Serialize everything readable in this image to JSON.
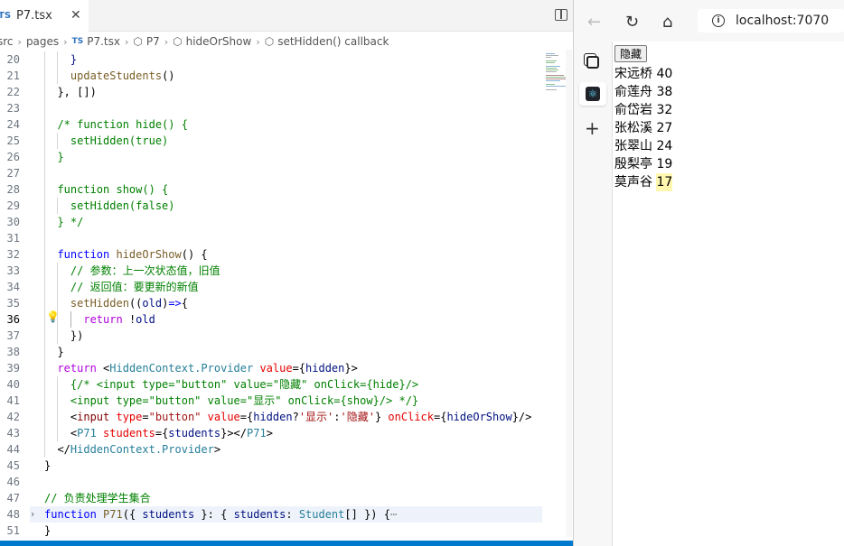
{
  "editor": {
    "tab": {
      "lang": "TS",
      "filename": "P7.tsx",
      "close": "✕"
    },
    "breadcrumb": [
      {
        "label": "src",
        "icon": ""
      },
      {
        "label": "pages",
        "icon": ""
      },
      {
        "label": "P7.tsx",
        "icon": "TS"
      },
      {
        "label": "P7",
        "icon": "cube"
      },
      {
        "label": "hideOrShow",
        "icon": "cube"
      },
      {
        "label": "setHidden() callback",
        "icon": "cube"
      }
    ],
    "lines": [
      {
        "n": "20",
        "html": "    <span class=\"v\">}</span>"
      },
      {
        "n": "21",
        "html": "    <span class=\"f\">updateStudents</span>()"
      },
      {
        "n": "22",
        "html": "  }, [])"
      },
      {
        "n": "23",
        "html": ""
      },
      {
        "n": "24",
        "html": "  <span class=\"c\">/* function hide() {</span>"
      },
      {
        "n": "25",
        "html": "    <span class=\"c\">setHidden(true)</span>"
      },
      {
        "n": "26",
        "html": "  <span class=\"c\">}</span>"
      },
      {
        "n": "27",
        "html": ""
      },
      {
        "n": "28",
        "html": "  <span class=\"c\">function show() {</span>"
      },
      {
        "n": "29",
        "html": "    <span class=\"c\">setHidden(false)</span>"
      },
      {
        "n": "30",
        "html": "  <span class=\"c\">} */</span>"
      },
      {
        "n": "31",
        "html": ""
      },
      {
        "n": "32",
        "html": "  <span class=\"k\">function</span> <span class=\"f\">hideOrShow</span>() {"
      },
      {
        "n": "33",
        "html": "    <span class=\"c\">// 参数：上一次状态值，旧值</span>"
      },
      {
        "n": "34",
        "html": "    <span class=\"c\">// 返回值：要更新的新值</span>"
      },
      {
        "n": "35",
        "html": "    <span class=\"f\">setHidden</span>((<span class=\"v\">old</span>)<span class=\"k\">=&gt;</span>{"
      },
      {
        "n": "36",
        "html": "      <span class=\"kc\">return</span> !<span class=\"v\">old</span>"
      },
      {
        "n": "37",
        "html": "    })"
      },
      {
        "n": "38",
        "html": "  }"
      },
      {
        "n": "39",
        "html": "  <span class=\"kc\">return</span> &lt;<span class=\"t\">HiddenContext.Provider</span> <span class=\"at\">value</span>={<span class=\"v\">hidden</span>}&gt;"
      },
      {
        "n": "40",
        "html": "    <span class=\"c\">{/* &lt;input type=\"button\" value=\"隐藏\" onClick={hide}/&gt;</span>"
      },
      {
        "n": "41",
        "html": "    <span class=\"c\">&lt;input type=\"button\" value=\"显示\" onClick={show}/&gt; */}</span>"
      },
      {
        "n": "42",
        "html": "    &lt;<span class=\"tg\">input</span> <span class=\"at\">type</span>=<span class=\"s\">\"button\"</span> <span class=\"at\">value</span>={<span class=\"v\">hidden</span>?<span class=\"s\">'显示'</span>:<span class=\"s\">'隐藏'</span>} <span class=\"at\">onClick</span>={<span class=\"v\">hideOrShow</span>}/&gt;"
      },
      {
        "n": "43",
        "html": "    &lt;<span class=\"t\">P71</span> <span class=\"at\">students</span>={<span class=\"v\">students</span>}&gt;&lt;/<span class=\"t\">P71</span>&gt;"
      },
      {
        "n": "44",
        "html": "  &lt;/<span class=\"t\">HiddenContext.Provider</span>&gt;"
      },
      {
        "n": "45",
        "html": "}"
      },
      {
        "n": "46",
        "html": ""
      },
      {
        "n": "47",
        "html": "<span class=\"c\">// 负责处理学生集合</span>"
      },
      {
        "n": "48",
        "html": "<span class=\"k\">function</span> <span class=\"f\">P71</span>({ <span class=\"v\">students</span> }: { <span class=\"v\">students</span>: <span class=\"t\">Student</span>[] }) {<span style=\"color:#888\">⋯</span>"
      },
      {
        "n": "51",
        "html": "}"
      }
    ]
  },
  "browser": {
    "url": "localhost:7070",
    "button_label": "隐藏",
    "students": [
      "宋远桥 40",
      "俞莲舟 38",
      "俞岱岩 32",
      "张松溪 27",
      "张翠山 24",
      "殷梨亭 19",
      "莫声谷 17"
    ]
  },
  "colors": {
    "statusbar": "#007acc",
    "keyword": "#0000ff",
    "comment": "#008000",
    "type": "#267f99"
  }
}
